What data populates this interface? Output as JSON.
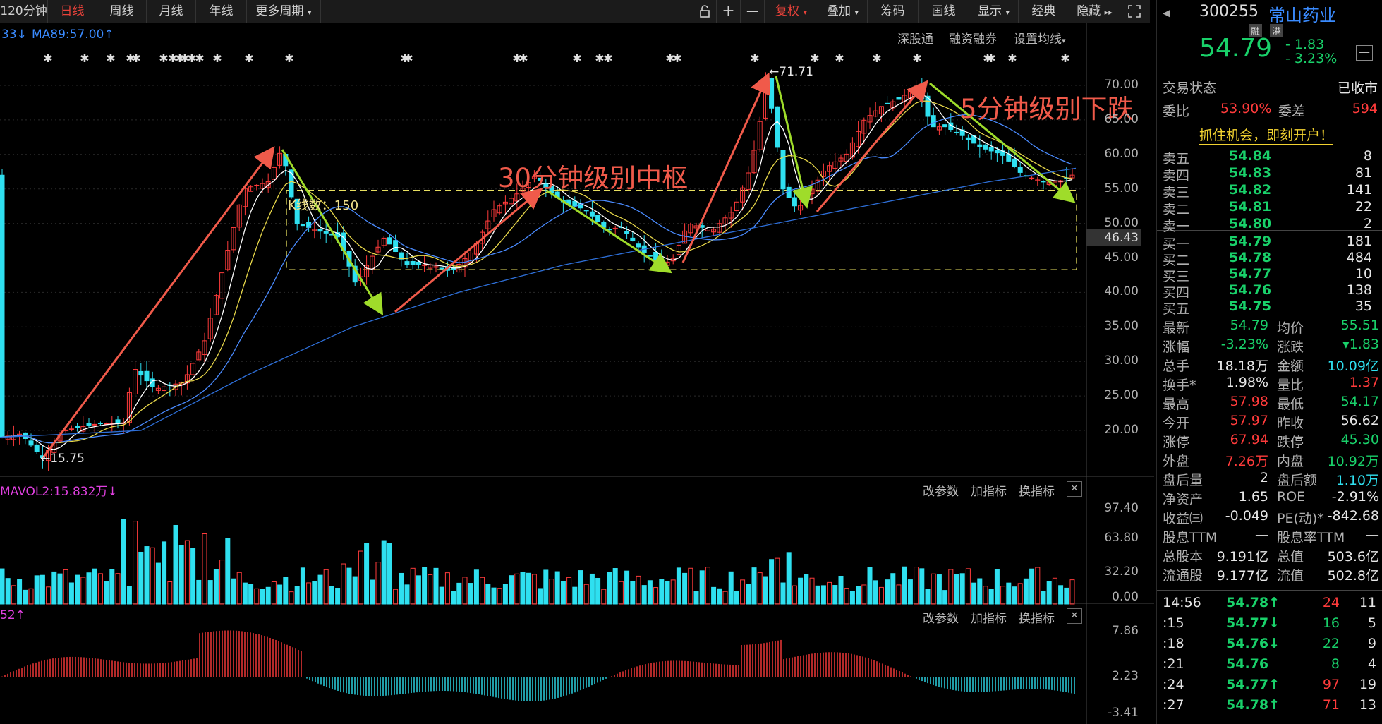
{
  "toolbar": {
    "period_120": "120分钟",
    "daily": "日线",
    "weekly": "周线",
    "monthly": "月线",
    "yearly": "年线",
    "more_periods": "更多周期",
    "more_arrow": "▾",
    "lock_icon": "lock-icon",
    "plus": "+",
    "minus": "—",
    "fuquan": "复权",
    "overlay": "叠加",
    "chips": "筹码",
    "draw": "画线",
    "display": "显示",
    "classic": "经典",
    "hide": "隐藏",
    "hide_arrow": "▸▸",
    "fullscreen_icon": "fullscreen-icon"
  },
  "infobar": {
    "ma_prefix": "33",
    "ma_prefix_arrow": "↓",
    "ma89": "MA89:57.00",
    "ma89_arrow": "↑",
    "links": [
      "深股通",
      "融资融券",
      "设置均线"
    ],
    "set_arrow": "▾"
  },
  "main_chart": {
    "price_axis": [
      "70.00",
      "65.00",
      "60.00",
      "55.00",
      "50.00",
      "45.00",
      "40.00",
      "35.00",
      "30.00",
      "25.00",
      "20.00"
    ],
    "current_price_tag": "46.43",
    "high_label": "71.71",
    "low_label": "15.75",
    "kline_count": "K线数：150",
    "annotation_30min": "30分钟级别中枢",
    "annotation_5min": "5分钟级别下跌"
  },
  "volume_panel": {
    "title": "MAVOL2:15.832万",
    "title_arrow": "↓",
    "axis": [
      "97.40",
      "63.80",
      "32.20",
      "0.00"
    ],
    "controls": [
      "改参数",
      "加指标",
      "换指标"
    ],
    "close": "✕"
  },
  "macd_panel": {
    "title": "52",
    "title_arrow": "↑",
    "axis": [
      "7.86",
      "2.23",
      "-3.41"
    ],
    "controls": [
      "改参数",
      "加指标",
      "换指标"
    ],
    "close": "✕"
  },
  "side": {
    "code": "300255",
    "name": "常山药业",
    "tag_rong": "融",
    "tag_gang": "港",
    "price": "54.79",
    "change": "- 1.83",
    "change_pct": "- 3.23%",
    "trade_status_label": "交易状态",
    "trade_status": "已收市",
    "weibi_label": "委比",
    "weibi": "53.90%",
    "weicha_label": "委差",
    "weicha": "594",
    "promo": "抓住机会，即刻开户！",
    "asks": [
      {
        "label": "卖五",
        "price": "54.84",
        "vol": "8"
      },
      {
        "label": "卖四",
        "price": "54.83",
        "vol": "81"
      },
      {
        "label": "卖三",
        "price": "54.82",
        "vol": "141"
      },
      {
        "label": "卖二",
        "price": "54.81",
        "vol": "22"
      },
      {
        "label": "卖一",
        "price": "54.80",
        "vol": "2"
      }
    ],
    "bids": [
      {
        "label": "买一",
        "price": "54.79",
        "vol": "181"
      },
      {
        "label": "买二",
        "price": "54.78",
        "vol": "484"
      },
      {
        "label": "买三",
        "price": "54.77",
        "vol": "10"
      },
      {
        "label": "买四",
        "price": "54.76",
        "vol": "138"
      },
      {
        "label": "买五",
        "price": "54.75",
        "vol": "35"
      }
    ],
    "stats": [
      {
        "l1": "最新",
        "v1": "54.79",
        "c1": "green",
        "l2": "均价",
        "v2": "55.51",
        "c2": "green"
      },
      {
        "l1": "涨幅",
        "v1": "-3.23%",
        "c1": "green",
        "l2": "涨跌",
        "v2": "▾1.83",
        "c2": "green"
      },
      {
        "l1": "总手",
        "v1": "18.18万",
        "c1": "white",
        "l2": "金额",
        "v2": "10.09亿",
        "c2": "cyan"
      },
      {
        "l1": "换手*",
        "v1": "1.98%",
        "c1": "white",
        "l2": "量比",
        "v2": "1.37",
        "c2": "red"
      },
      {
        "l1": "最高",
        "v1": "57.98",
        "c1": "red",
        "l2": "最低",
        "v2": "54.17",
        "c2": "green"
      },
      {
        "l1": "今开",
        "v1": "57.97",
        "c1": "red",
        "l2": "昨收",
        "v2": "56.62",
        "c2": "white"
      },
      {
        "l1": "涨停",
        "v1": "67.94",
        "c1": "red",
        "l2": "跌停",
        "v2": "45.30",
        "c2": "green"
      },
      {
        "l1": "外盘",
        "v1": "7.26万",
        "c1": "red",
        "l2": "内盘",
        "v2": "10.92万",
        "c2": "green"
      },
      {
        "l1": "盘后量",
        "v1": "2",
        "c1": "white",
        "l2": "盘后额",
        "v2": "1.10万",
        "c2": "cyan"
      },
      {
        "l1": "净资产",
        "v1": "1.65",
        "c1": "white",
        "l2": "ROE",
        "v2": "-2.91%",
        "c2": "white"
      },
      {
        "l1": "收益㈢",
        "v1": "-0.049",
        "c1": "white",
        "l2": "PE(动)*",
        "v2": "-842.68",
        "c2": "white"
      },
      {
        "l1": "股息TTM",
        "v1": "—",
        "c1": "white",
        "l2": "股息率TTM",
        "v2": "—",
        "c2": "white"
      },
      {
        "l1": "总股本",
        "v1": "9.191亿",
        "c1": "white",
        "l2": "总值",
        "v2": "503.6亿",
        "c2": "white"
      },
      {
        "l1": "流通股",
        "v1": "9.177亿",
        "c1": "white",
        "l2": "流值",
        "v2": "502.8亿",
        "c2": "white"
      }
    ],
    "ticks": [
      {
        "time": "14:56",
        "price": "54.78",
        "dir": "↑",
        "dc": "red",
        "vol": "24",
        "vc": "red",
        "n": "11"
      },
      {
        "time": ":15",
        "price": "54.77",
        "dir": "↓",
        "dc": "green",
        "vol": "16",
        "vc": "green",
        "n": "5"
      },
      {
        "time": ":18",
        "price": "54.76",
        "dir": "↓",
        "dc": "green",
        "vol": "22",
        "vc": "green",
        "n": "9"
      },
      {
        "time": ":21",
        "price": "54.76",
        "dir": "",
        "dc": "green",
        "vol": "8",
        "vc": "green",
        "n": "4"
      },
      {
        "time": ":24",
        "price": "54.77",
        "dir": "↑",
        "dc": "red",
        "vol": "97",
        "vc": "red",
        "n": "19"
      },
      {
        "time": ":27",
        "price": "54.78",
        "dir": "↑",
        "dc": "red",
        "vol": "71",
        "vc": "red",
        "n": "13"
      }
    ]
  },
  "colors": {
    "up": "#ff3b3b",
    "down": "#2fe0f0",
    "annotation": "#f05a4a",
    "arrow_green": "#9fdc2a",
    "box": "#e8e060"
  }
}
